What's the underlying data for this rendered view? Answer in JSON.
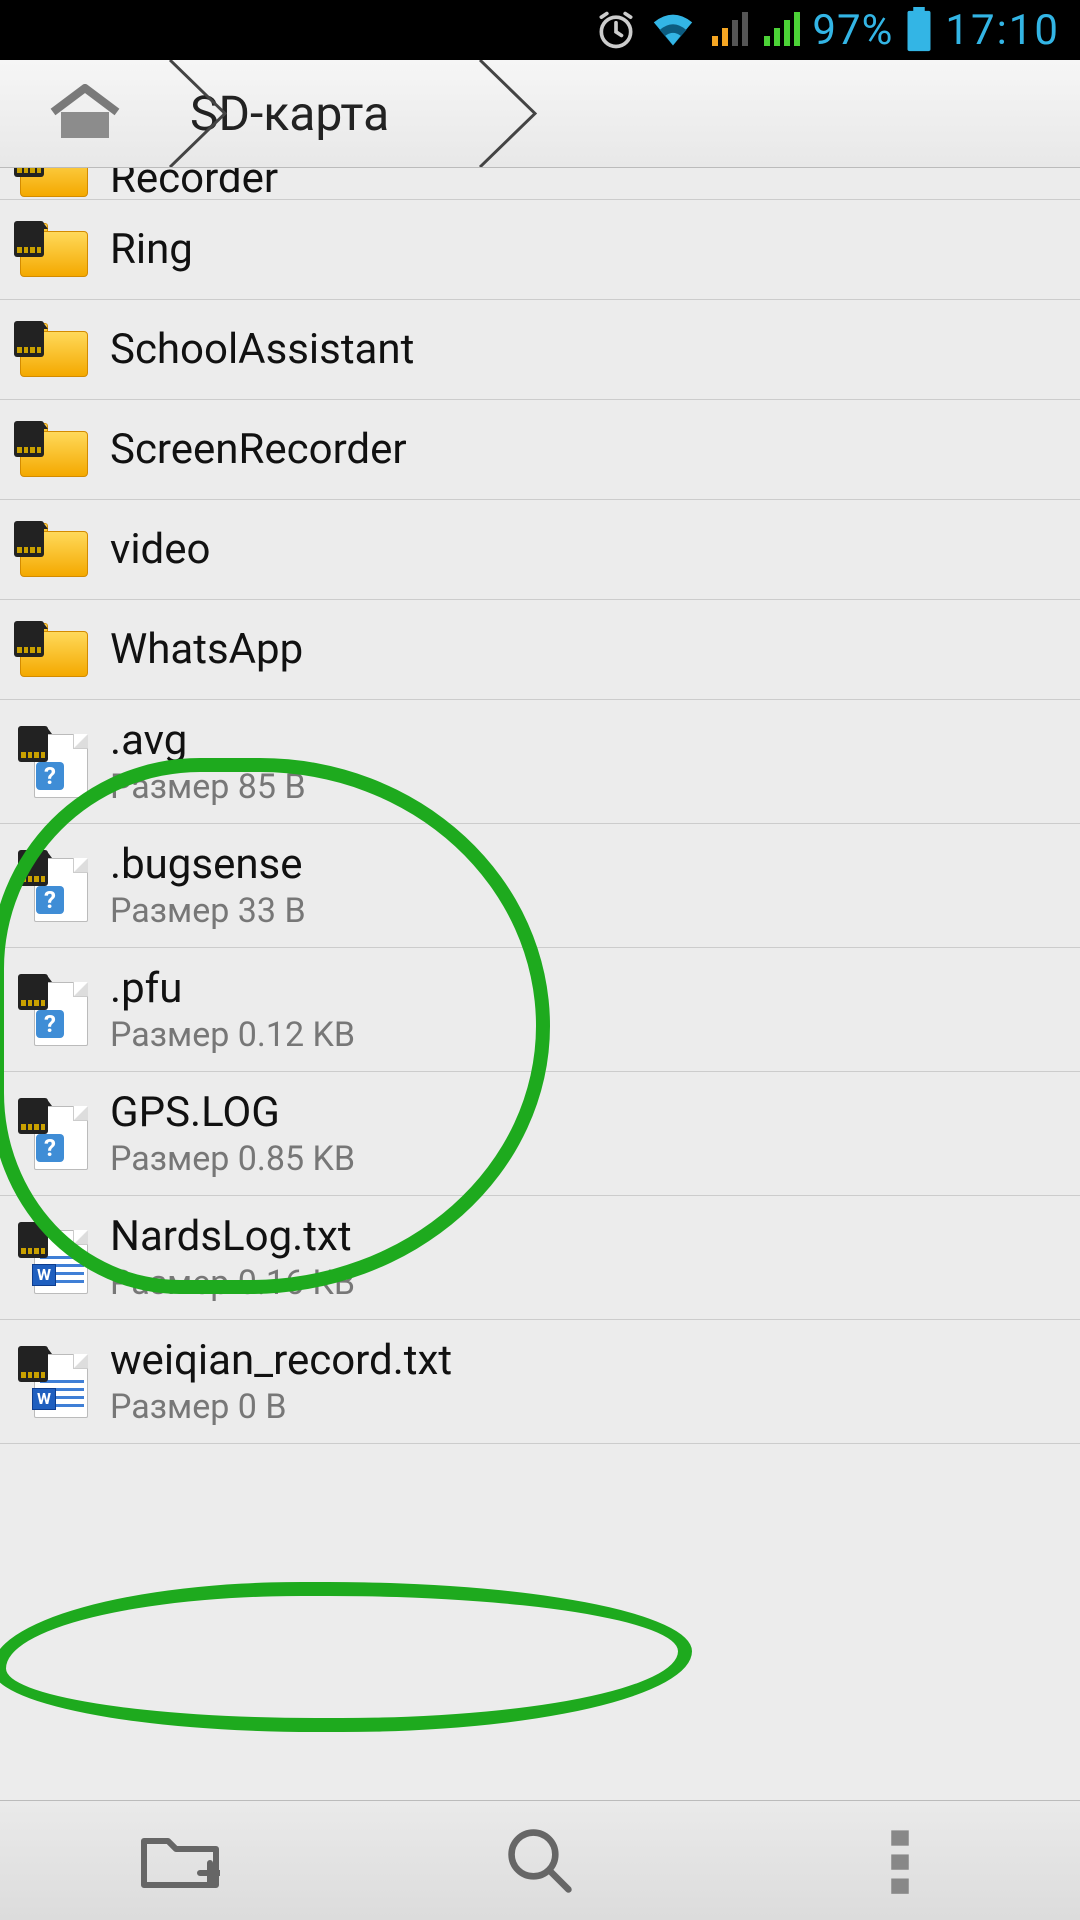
{
  "status": {
    "battery_pct": "97%",
    "time": "17:10"
  },
  "breadcrumb": {
    "current": "SD-карта"
  },
  "size_prefix": "Размер",
  "partial_top_name": "Recorder",
  "items": [
    {
      "kind": "folder",
      "name": "Ring"
    },
    {
      "kind": "folder",
      "name": "SchoolAssistant"
    },
    {
      "kind": "folder",
      "name": "ScreenRecorder"
    },
    {
      "kind": "folder",
      "name": "video"
    },
    {
      "kind": "folder",
      "name": "WhatsApp"
    },
    {
      "kind": "file-unknown",
      "name": ".avg",
      "size": "85 B"
    },
    {
      "kind": "file-unknown",
      "name": ".bugsense",
      "size": "33 B"
    },
    {
      "kind": "file-unknown",
      "name": ".pfu",
      "size": "0.12 KB"
    },
    {
      "kind": "file-unknown",
      "name": "GPS.LOG",
      "size": "0.85 KB"
    },
    {
      "kind": "file-txt",
      "name": "NardsLog.txt",
      "size": "0.16 KB"
    },
    {
      "kind": "file-txt",
      "name": "weiqian_record.txt",
      "size": "0 B"
    }
  ]
}
